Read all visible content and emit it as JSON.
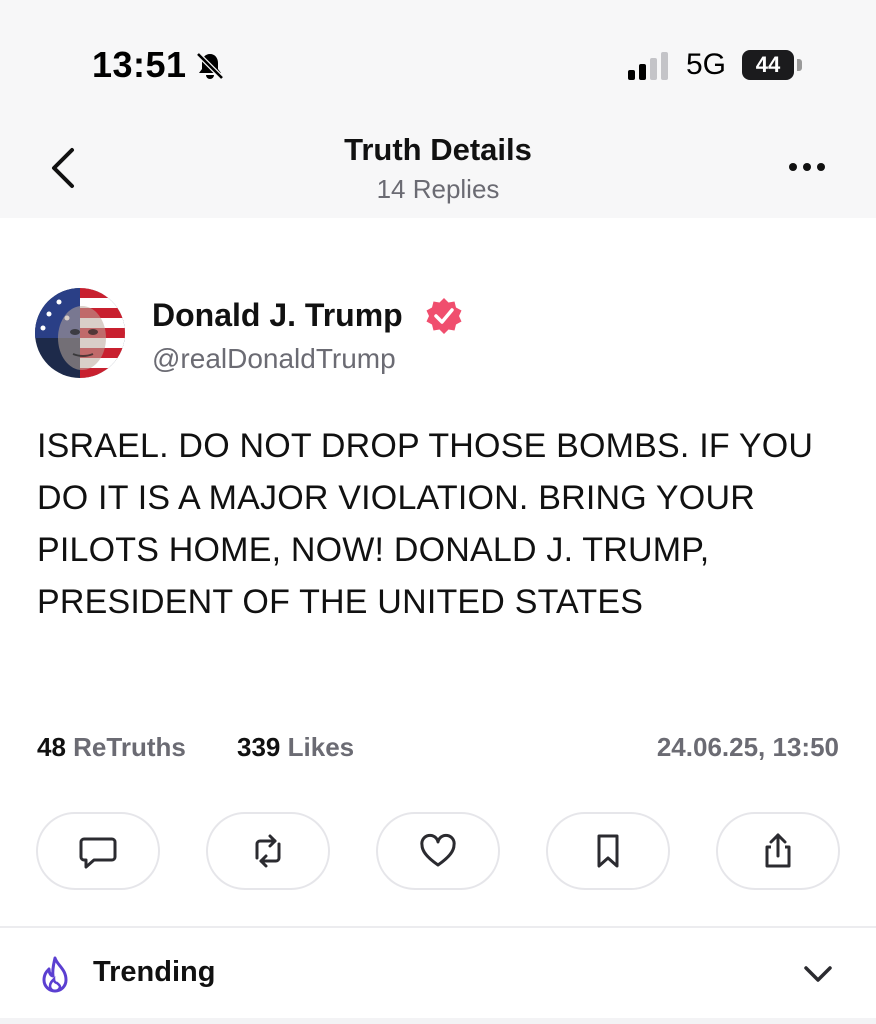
{
  "status_bar": {
    "time": "13:51",
    "network": "5G",
    "battery": "44",
    "icons": [
      "bell-slash-icon",
      "signal-icon"
    ]
  },
  "header": {
    "title": "Truth Details",
    "subtitle": "14 Replies",
    "back_icon": "chevron-left-icon",
    "menu_icon": "more-horizontal-icon"
  },
  "post": {
    "author_name": "Donald J. Trump",
    "author_handle": "@realDonaldTrump",
    "verified_icon": "verified-badge-icon",
    "body": "ISRAEL. DO NOT DROP THOSE BOMBS. IF YOU DO IT IS A MAJOR VIOLATION. BRING YOUR PILOTS HOME, NOW! DONALD J. TRUMP, PRESIDENT OF THE UNITED STATES",
    "retruths_count": "48",
    "retruths_label": "ReTruths",
    "likes_count": "339",
    "likes_label": "Likes",
    "timestamp": "24.06.25, 13:50"
  },
  "actions": [
    {
      "name": "reply",
      "icon": "comment-icon"
    },
    {
      "name": "retruth",
      "icon": "repost-icon"
    },
    {
      "name": "like",
      "icon": "heart-icon"
    },
    {
      "name": "bookmark",
      "icon": "bookmark-icon"
    },
    {
      "name": "share",
      "icon": "share-icon"
    }
  ],
  "trending": {
    "label": "Trending",
    "icon": "flame-icon",
    "expand_icon": "chevron-down-icon"
  },
  "colors": {
    "verified": "#f04e6e",
    "flame": "#5b3fd1",
    "muted_text": "#6b6b73",
    "button_border": "#e6e6ea"
  }
}
